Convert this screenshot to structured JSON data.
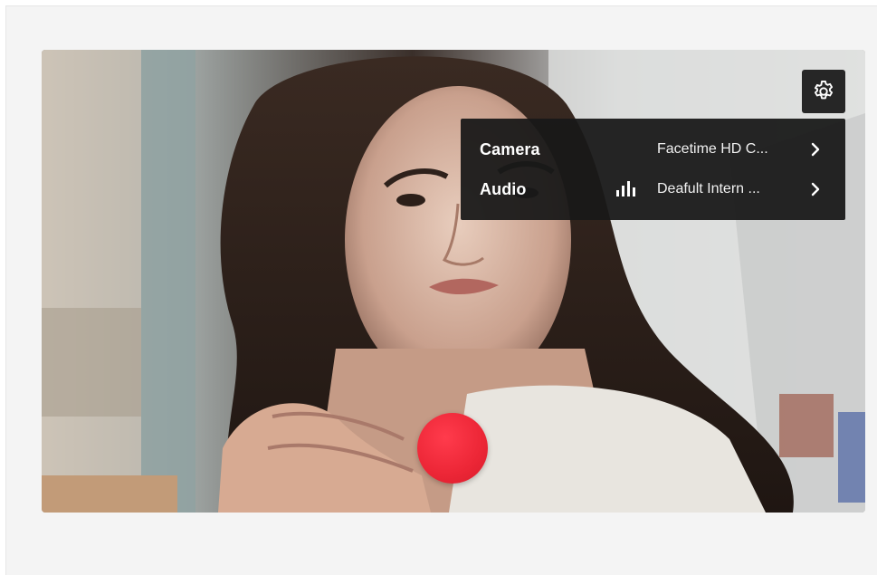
{
  "settings": {
    "icon": "gear-icon",
    "rows": [
      {
        "label": "Camera",
        "value": "Facetime HD C...",
        "icon": "chevron-right-icon"
      },
      {
        "label": "Audio",
        "value": "Deafult Intern ...",
        "icon": "chevron-right-icon",
        "meter_icon": "audio-level-icon"
      }
    ]
  },
  "record": {
    "icon": "record-icon",
    "color": "#ec2636"
  },
  "colors": {
    "menu_background": "#181818",
    "button_background": "#262626",
    "page_background": "#f4f4f4"
  }
}
